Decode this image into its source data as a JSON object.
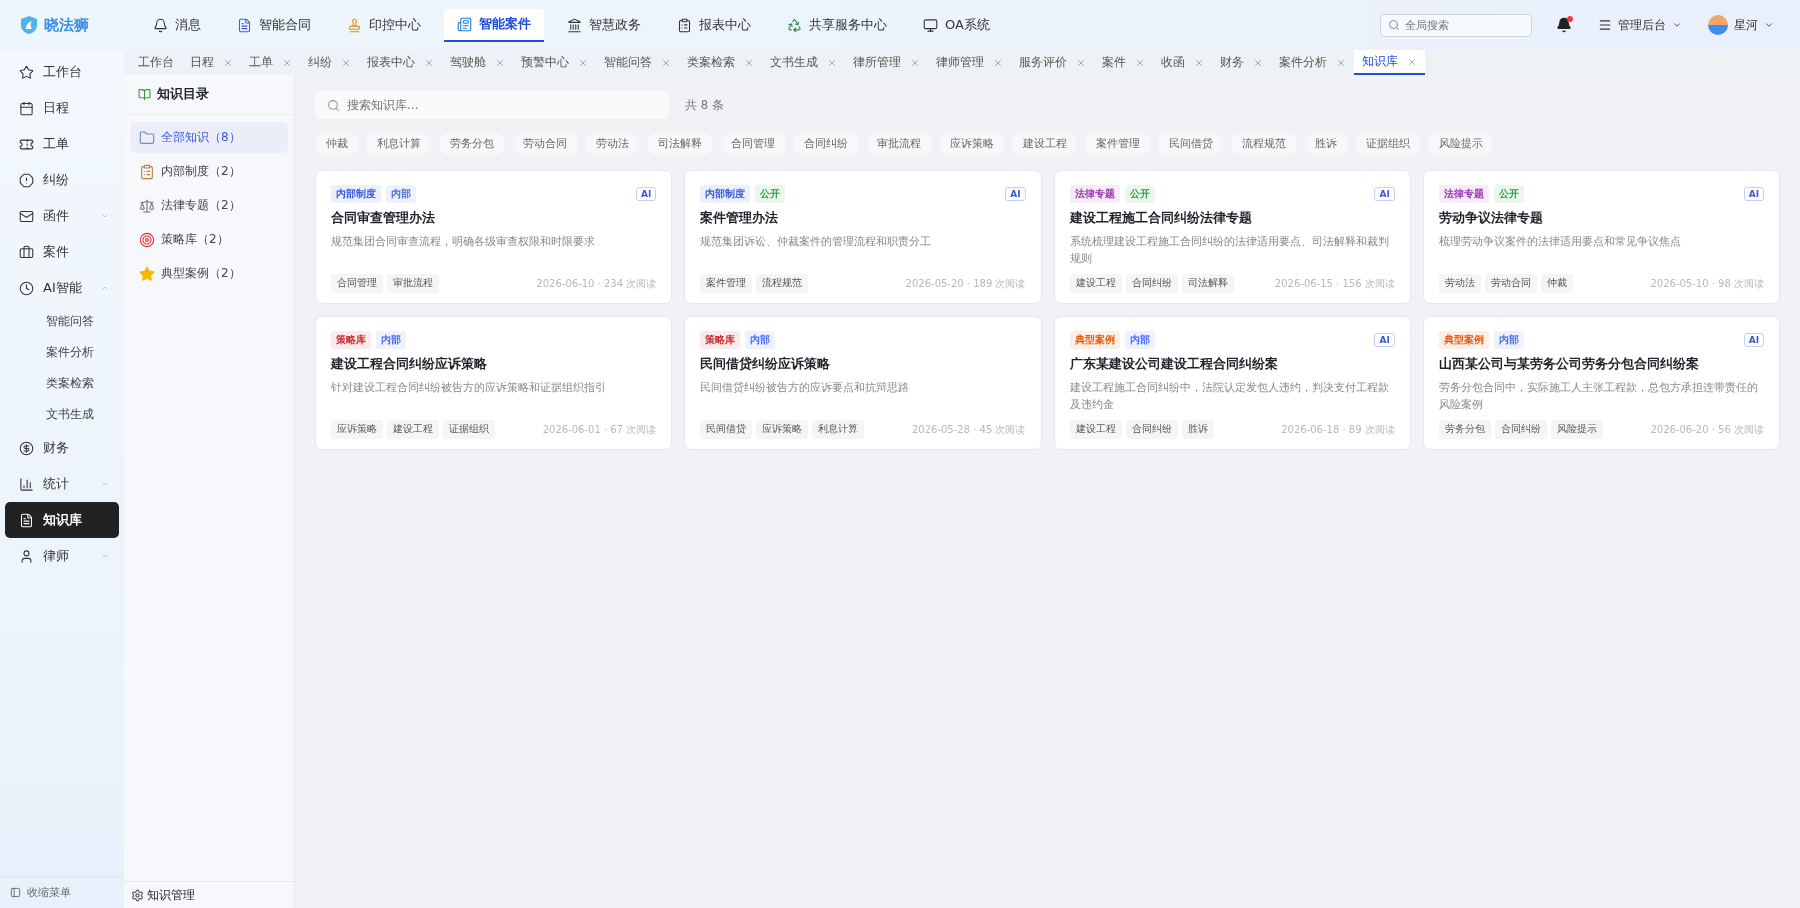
{
  "app": {
    "name": "晓法狮"
  },
  "top_nav": [
    {
      "label": "消息",
      "selected": false
    },
    {
      "label": "智能合同",
      "selected": false
    },
    {
      "label": "印控中心",
      "selected": false
    },
    {
      "label": "智能案件",
      "selected": true
    },
    {
      "label": "智慧政务",
      "selected": false
    },
    {
      "label": "报表中心",
      "selected": false
    },
    {
      "label": "共享服务中心",
      "selected": false
    },
    {
      "label": "OA系统",
      "selected": false
    }
  ],
  "header": {
    "search_placeholder": "全局搜索",
    "notification_dot": true,
    "admin": "管理后台",
    "user": "星河"
  },
  "tabs": [
    {
      "label": "工作台",
      "closable": false,
      "selected": false
    },
    {
      "label": "日程",
      "closable": true,
      "selected": false
    },
    {
      "label": "工单",
      "closable": true,
      "selected": false
    },
    {
      "label": "纠纷",
      "closable": true,
      "selected": false
    },
    {
      "label": "报表中心",
      "closable": true,
      "selected": false
    },
    {
      "label": "驾驶舱",
      "closable": true,
      "selected": false
    },
    {
      "label": "预警中心",
      "closable": true,
      "selected": false
    },
    {
      "label": "智能问答",
      "closable": true,
      "selected": false
    },
    {
      "label": "类案检索",
      "closable": true,
      "selected": false
    },
    {
      "label": "文书生成",
      "closable": true,
      "selected": false
    },
    {
      "label": "律所管理",
      "closable": true,
      "selected": false
    },
    {
      "label": "律师管理",
      "closable": true,
      "selected": false
    },
    {
      "label": "服务评价",
      "closable": true,
      "selected": false
    },
    {
      "label": "案件",
      "closable": true,
      "selected": false
    },
    {
      "label": "收函",
      "closable": true,
      "selected": false
    },
    {
      "label": "财务",
      "closable": true,
      "selected": false
    },
    {
      "label": "案件分析",
      "closable": true,
      "selected": false
    },
    {
      "label": "知识库",
      "closable": true,
      "selected": true
    }
  ],
  "sidebar": {
    "items": [
      {
        "label": "工作台",
        "selected": false
      },
      {
        "label": "日程",
        "selected": false
      },
      {
        "label": "工单",
        "selected": false
      },
      {
        "label": "纠纷",
        "selected": false
      },
      {
        "label": "函件",
        "selected": false,
        "expanded": false
      },
      {
        "label": "案件",
        "selected": false
      },
      {
        "label": "AI智能",
        "selected": false,
        "expanded": true,
        "children": [
          {
            "label": "智能问答",
            "selected": false
          },
          {
            "label": "案件分析",
            "selected": false
          },
          {
            "label": "类案检索",
            "selected": false
          },
          {
            "label": "文书生成",
            "selected": false
          }
        ]
      },
      {
        "label": "财务",
        "selected": false
      },
      {
        "label": "统计",
        "selected": false,
        "expanded": false
      },
      {
        "label": "知识库",
        "selected": true
      },
      {
        "label": "律师",
        "selected": false,
        "expanded": false
      }
    ],
    "collapse": "收缩菜单"
  },
  "catalog": {
    "title": "知识目录",
    "items": [
      {
        "label": "全部知识（8）",
        "selected": true
      },
      {
        "label": "内部制度（2）",
        "selected": false
      },
      {
        "label": "法律专题（2）",
        "selected": false
      },
      {
        "label": "策略库（2）",
        "selected": false
      },
      {
        "label": "典型案例（2）",
        "selected": false
      }
    ],
    "footer": "知识管理"
  },
  "search": {
    "placeholder": "搜索知识库...",
    "count": "共 8 条"
  },
  "tag_filters": [
    "仲裁",
    "利息计算",
    "劳务分包",
    "劳动合同",
    "劳动法",
    "司法解释",
    "合同管理",
    "合同纠纷",
    "审批流程",
    "应诉策略",
    "建设工程",
    "案件管理",
    "民间借贷",
    "流程规范",
    "胜诉",
    "证据组织",
    "风险提示"
  ],
  "cards": [
    {
      "category": {
        "label": "内部制度",
        "color": "#3b5bdb"
      },
      "visibility": {
        "label": "内部",
        "color": "#4c6ef5"
      },
      "ai": "AI",
      "title": "合同审查管理办法",
      "summary": "规范集团合同审查流程，明确各级审查权限和时限要求",
      "tags": [
        "合同管理",
        "审批流程"
      ],
      "meta": "2026-06-10 · 234 次阅读"
    },
    {
      "category": {
        "label": "内部制度",
        "color": "#3b5bdb"
      },
      "visibility": {
        "label": "公开",
        "color": "#2f9e44"
      },
      "ai": "AI",
      "title": "案件管理办法",
      "summary": "规范集团诉讼、仲裁案件的管理流程和职责分工",
      "tags": [
        "案件管理",
        "流程规范"
      ],
      "meta": "2026-05-20 · 189 次阅读"
    },
    {
      "category": {
        "label": "法律专题",
        "color": "#9c36b5"
      },
      "visibility": {
        "label": "公开",
        "color": "#2f9e44"
      },
      "ai": "AI",
      "title": "建设工程施工合同纠纷法律专题",
      "summary": "系统梳理建设工程施工合同纠纷的法律适用要点、司法解释和裁判规则",
      "tags": [
        "建设工程",
        "合同纠纷",
        "司法解释"
      ],
      "meta": "2026-06-15 · 156 次阅读"
    },
    {
      "category": {
        "label": "法律专题",
        "color": "#9c36b5"
      },
      "visibility": {
        "label": "公开",
        "color": "#2f9e44"
      },
      "ai": "AI",
      "title": "劳动争议法律专题",
      "summary": "梳理劳动争议案件的法律适用要点和常见争议焦点",
      "tags": [
        "劳动法",
        "劳动合同",
        "仲裁"
      ],
      "meta": "2026-05-10 · 98 次阅读"
    },
    {
      "category": {
        "label": "策略库",
        "color": "#c92a2a"
      },
      "visibility": {
        "label": "内部",
        "color": "#4c6ef5"
      },
      "title": "建设工程合同纠纷应诉策略",
      "summary": "针对建设工程合同纠纷被告方的应诉策略和证据组织指引",
      "tags": [
        "应诉策略",
        "建设工程",
        "证据组织"
      ],
      "meta": "2026-06-01 · 67 次阅读"
    },
    {
      "category": {
        "label": "策略库",
        "color": "#c92a2a"
      },
      "visibility": {
        "label": "内部",
        "color": "#4c6ef5"
      },
      "title": "民间借贷纠纷应诉策略",
      "summary": "民间借贷纠纷被告方的应诉要点和抗辩思路",
      "tags": [
        "民间借贷",
        "应诉策略",
        "利息计算"
      ],
      "meta": "2026-05-28 · 45 次阅读"
    },
    {
      "category": {
        "label": "典型案例",
        "color": "#e8590c"
      },
      "visibility": {
        "label": "内部",
        "color": "#4c6ef5"
      },
      "ai": "AI",
      "title": "广东某建设公司建设工程合同纠纷案",
      "summary": "建设工程施工合同纠纷中，法院认定发包人违约，判决支付工程款及违约金",
      "tags": [
        "建设工程",
        "合同纠纷",
        "胜诉"
      ],
      "meta": "2026-06-18 · 89 次阅读"
    },
    {
      "category": {
        "label": "典型案例",
        "color": "#e8590c"
      },
      "visibility": {
        "label": "内部",
        "color": "#4c6ef5"
      },
      "ai": "AI",
      "title": "山西某公司与某劳务公司劳务分包合同纠纷案",
      "summary": "劳务分包合同中，实际施工人主张工程款，总包方承担连带责任的风险案例",
      "tags": [
        "劳务分包",
        "合同纠纷",
        "风险提示"
      ],
      "meta": "2026-06-20 · 56 次阅读"
    }
  ]
}
